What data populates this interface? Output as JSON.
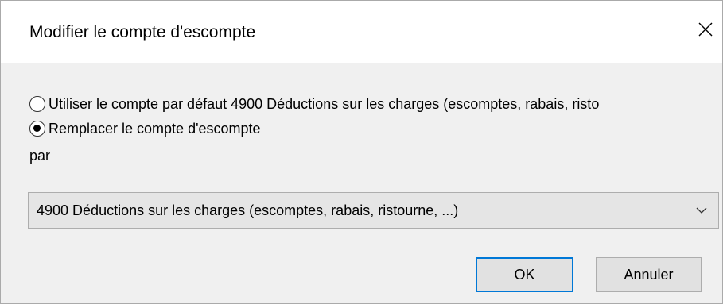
{
  "dialog": {
    "title": "Modifier le compte d'escompte",
    "close_icon": "close-icon"
  },
  "options": {
    "default_label": "Utiliser le compte par défaut 4900 Déductions sur les charges (escomptes, rabais, risto",
    "default_checked": false,
    "replace_label": "Remplacer le compte d'escompte",
    "replace_checked": true
  },
  "par_label": "par",
  "account_select": {
    "value": "4900 Déductions sur les charges (escomptes, rabais, ristourne, ...)",
    "arrow_icon": "chevron-down-icon"
  },
  "buttons": {
    "ok": "OK",
    "cancel": "Annuler"
  },
  "colors": {
    "focus_border": "#0078d7",
    "dialog_background": "#f0f0f0"
  }
}
